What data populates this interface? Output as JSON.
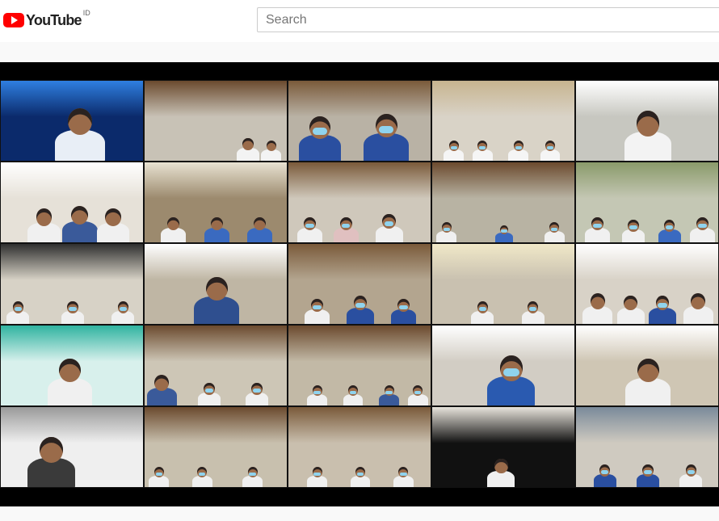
{
  "header": {
    "logo_text": "YouTube",
    "country_code": "ID",
    "search_placeholder": "Search"
  },
  "video": {
    "tiles": [
      {
        "bg": "#0b2a6b",
        "accent": "#2f7fe0",
        "people": [
          {
            "x": 0.55,
            "s": 1.0,
            "shirt": "#e8eef6",
            "mask": false
          }
        ]
      },
      {
        "bg": "#c8c2b6",
        "accent": "#6b4a2e",
        "people": [
          {
            "x": 0.72,
            "s": 0.45,
            "shirt": "#f3f3f3",
            "mask": false
          },
          {
            "x": 0.88,
            "s": 0.4,
            "shirt": "#f3f3f3",
            "mask": false
          }
        ]
      },
      {
        "bg": "#b9b2a5",
        "accent": "#7a5a3a",
        "people": [
          {
            "x": 0.22,
            "s": 0.85,
            "shirt": "#2a4fa0",
            "mask": true
          },
          {
            "x": 0.68,
            "s": 0.9,
            "shirt": "#2a4fa0",
            "mask": true
          }
        ]
      },
      {
        "bg": "#d9d3c7",
        "accent": "#c7b48f",
        "people": [
          {
            "x": 0.15,
            "s": 0.4,
            "shirt": "#f5f5f5",
            "mask": true
          },
          {
            "x": 0.35,
            "s": 0.4,
            "shirt": "#f5f5f5",
            "mask": true
          },
          {
            "x": 0.6,
            "s": 0.4,
            "shirt": "#f5f5f5",
            "mask": true
          },
          {
            "x": 0.82,
            "s": 0.4,
            "shirt": "#f5f5f5",
            "mask": true
          }
        ]
      },
      {
        "bg": "#c7c7c0",
        "accent": "#ffffff",
        "people": [
          {
            "x": 0.5,
            "s": 0.95,
            "shirt": "#f3f3f3",
            "mask": false
          }
        ]
      },
      {
        "bg": "#e6e1d8",
        "accent": "#ffffff",
        "people": [
          {
            "x": 0.3,
            "s": 0.65,
            "shirt": "#f0f0f0",
            "mask": false
          },
          {
            "x": 0.55,
            "s": 0.7,
            "shirt": "#3a5a9a",
            "mask": false
          },
          {
            "x": 0.78,
            "s": 0.65,
            "shirt": "#f0f0f0",
            "mask": false
          }
        ]
      },
      {
        "bg": "#9c8a6e",
        "accent": "#e8e2d2",
        "people": [
          {
            "x": 0.2,
            "s": 0.5,
            "shirt": "#f0f0f0",
            "mask": false
          },
          {
            "x": 0.5,
            "s": 0.5,
            "shirt": "#3a6ac0",
            "mask": false
          },
          {
            "x": 0.8,
            "s": 0.5,
            "shirt": "#3a6ac0",
            "mask": false
          }
        ]
      },
      {
        "bg": "#cfc8bb",
        "accent": "#7a5a3a",
        "people": [
          {
            "x": 0.15,
            "s": 0.5,
            "shirt": "#f0f0f0",
            "mask": true
          },
          {
            "x": 0.4,
            "s": 0.5,
            "shirt": "#e0c0c0",
            "mask": true
          },
          {
            "x": 0.7,
            "s": 0.55,
            "shirt": "#f0f0f0",
            "mask": true
          }
        ]
      },
      {
        "bg": "#b8b3a3",
        "accent": "#6b4a2e",
        "people": [
          {
            "x": 0.1,
            "s": 0.4,
            "shirt": "#f0f0f0",
            "mask": true
          },
          {
            "x": 0.5,
            "s": 0.35,
            "shirt": "#3a6ac0",
            "mask": true
          },
          {
            "x": 0.85,
            "s": 0.4,
            "shirt": "#f0f0f0",
            "mask": true
          }
        ]
      },
      {
        "bg": "#c4c7b4",
        "accent": "#8a9a6a",
        "people": [
          {
            "x": 0.15,
            "s": 0.5,
            "shirt": "#f0f0f0",
            "mask": true
          },
          {
            "x": 0.4,
            "s": 0.45,
            "shirt": "#f0f0f0",
            "mask": true
          },
          {
            "x": 0.65,
            "s": 0.45,
            "shirt": "#3a6ac0",
            "mask": true
          },
          {
            "x": 0.88,
            "s": 0.5,
            "shirt": "#f0f0f0",
            "mask": true
          }
        ]
      },
      {
        "bg": "#d7d2c6",
        "accent": "#2f2f2f",
        "people": [
          {
            "x": 0.12,
            "s": 0.45,
            "shirt": "#f0f0f0",
            "mask": true
          },
          {
            "x": 0.5,
            "s": 0.45,
            "shirt": "#f0f0f0",
            "mask": true
          },
          {
            "x": 0.85,
            "s": 0.45,
            "shirt": "#f0f0f0",
            "mask": true
          }
        ]
      },
      {
        "bg": "#bfb6a4",
        "accent": "#ffffff",
        "people": [
          {
            "x": 0.5,
            "s": 0.9,
            "shirt": "#2f4f8f",
            "mask": false
          }
        ]
      },
      {
        "bg": "#b3a58f",
        "accent": "#7a5a3a",
        "people": [
          {
            "x": 0.2,
            "s": 0.5,
            "shirt": "#f0f0f0",
            "mask": true
          },
          {
            "x": 0.5,
            "s": 0.55,
            "shirt": "#2a4fa0",
            "mask": true
          },
          {
            "x": 0.8,
            "s": 0.5,
            "shirt": "#2a4fa0",
            "mask": true
          }
        ]
      },
      {
        "bg": "#c9c1b0",
        "accent": "#f0e8c8",
        "people": [
          {
            "x": 0.35,
            "s": 0.45,
            "shirt": "#f0f0f0",
            "mask": true
          },
          {
            "x": 0.7,
            "s": 0.45,
            "shirt": "#f0f0f0",
            "mask": true
          }
        ]
      },
      {
        "bg": "#d8d2c7",
        "accent": "#ffffff",
        "people": [
          {
            "x": 0.15,
            "s": 0.6,
            "shirt": "#f0f0f0",
            "mask": false
          },
          {
            "x": 0.38,
            "s": 0.55,
            "shirt": "#f0f0f0",
            "mask": false
          },
          {
            "x": 0.6,
            "s": 0.55,
            "shirt": "#2a4fa0",
            "mask": true
          },
          {
            "x": 0.85,
            "s": 0.6,
            "shirt": "#f0f0f0",
            "mask": false
          }
        ]
      },
      {
        "bg": "#d8f0ec",
        "accent": "#2fb3a0",
        "people": [
          {
            "x": 0.48,
            "s": 0.9,
            "shirt": "#f0f0f0",
            "mask": false
          }
        ]
      },
      {
        "bg": "#cdc6b6",
        "accent": "#6b4a2e",
        "people": [
          {
            "x": 0.12,
            "s": 0.6,
            "shirt": "#3a5a9a",
            "mask": false
          },
          {
            "x": 0.45,
            "s": 0.45,
            "shirt": "#f0f0f0",
            "mask": true
          },
          {
            "x": 0.78,
            "s": 0.45,
            "shirt": "#f0f0f0",
            "mask": true
          }
        ]
      },
      {
        "bg": "#c2b9a6",
        "accent": "#6b4a2e",
        "people": [
          {
            "x": 0.2,
            "s": 0.4,
            "shirt": "#f0f0f0",
            "mask": true
          },
          {
            "x": 0.45,
            "s": 0.4,
            "shirt": "#f0f0f0",
            "mask": true
          },
          {
            "x": 0.7,
            "s": 0.4,
            "shirt": "#3a5a9a",
            "mask": true
          },
          {
            "x": 0.9,
            "s": 0.4,
            "shirt": "#f0f0f0",
            "mask": true
          }
        ]
      },
      {
        "bg": "#d2cdc4",
        "accent": "#ffffff",
        "people": [
          {
            "x": 0.55,
            "s": 0.95,
            "shirt": "#2a5ab0",
            "mask": true
          }
        ]
      },
      {
        "bg": "#cfc6b4",
        "accent": "#ffffff",
        "people": [
          {
            "x": 0.5,
            "s": 0.9,
            "shirt": "#f0f0f0",
            "mask": false
          }
        ]
      },
      {
        "bg": "#efefef",
        "accent": "#9a9a9a",
        "people": [
          {
            "x": 0.35,
            "s": 0.95,
            "shirt": "#3a3a3a",
            "mask": false
          }
        ]
      },
      {
        "bg": "#c8c0ae",
        "accent": "#6b4a2e",
        "people": [
          {
            "x": 0.1,
            "s": 0.4,
            "shirt": "#f0f0f0",
            "mask": true
          },
          {
            "x": 0.4,
            "s": 0.4,
            "shirt": "#f0f0f0",
            "mask": true
          },
          {
            "x": 0.75,
            "s": 0.4,
            "shirt": "#f0f0f0",
            "mask": true
          }
        ]
      },
      {
        "bg": "#c9bfae",
        "accent": "#7a5a3a",
        "people": [
          {
            "x": 0.2,
            "s": 0.4,
            "shirt": "#f0f0f0",
            "mask": true
          },
          {
            "x": 0.5,
            "s": 0.4,
            "shirt": "#f0f0f0",
            "mask": true
          },
          {
            "x": 0.8,
            "s": 0.4,
            "shirt": "#f0f0f0",
            "mask": true
          }
        ]
      },
      {
        "bg": "#111111",
        "accent": "#e8e4dc",
        "people": [
          {
            "x": 0.48,
            "s": 0.55,
            "shirt": "#f0f0f0",
            "mask": false
          }
        ]
      },
      {
        "bg": "#cfcac0",
        "accent": "#7a8a9a",
        "people": [
          {
            "x": 0.2,
            "s": 0.45,
            "shirt": "#2a4fa0",
            "mask": true
          },
          {
            "x": 0.5,
            "s": 0.45,
            "shirt": "#2a4fa0",
            "mask": true
          },
          {
            "x": 0.8,
            "s": 0.45,
            "shirt": "#f0f0f0",
            "mask": true
          }
        ]
      }
    ]
  }
}
